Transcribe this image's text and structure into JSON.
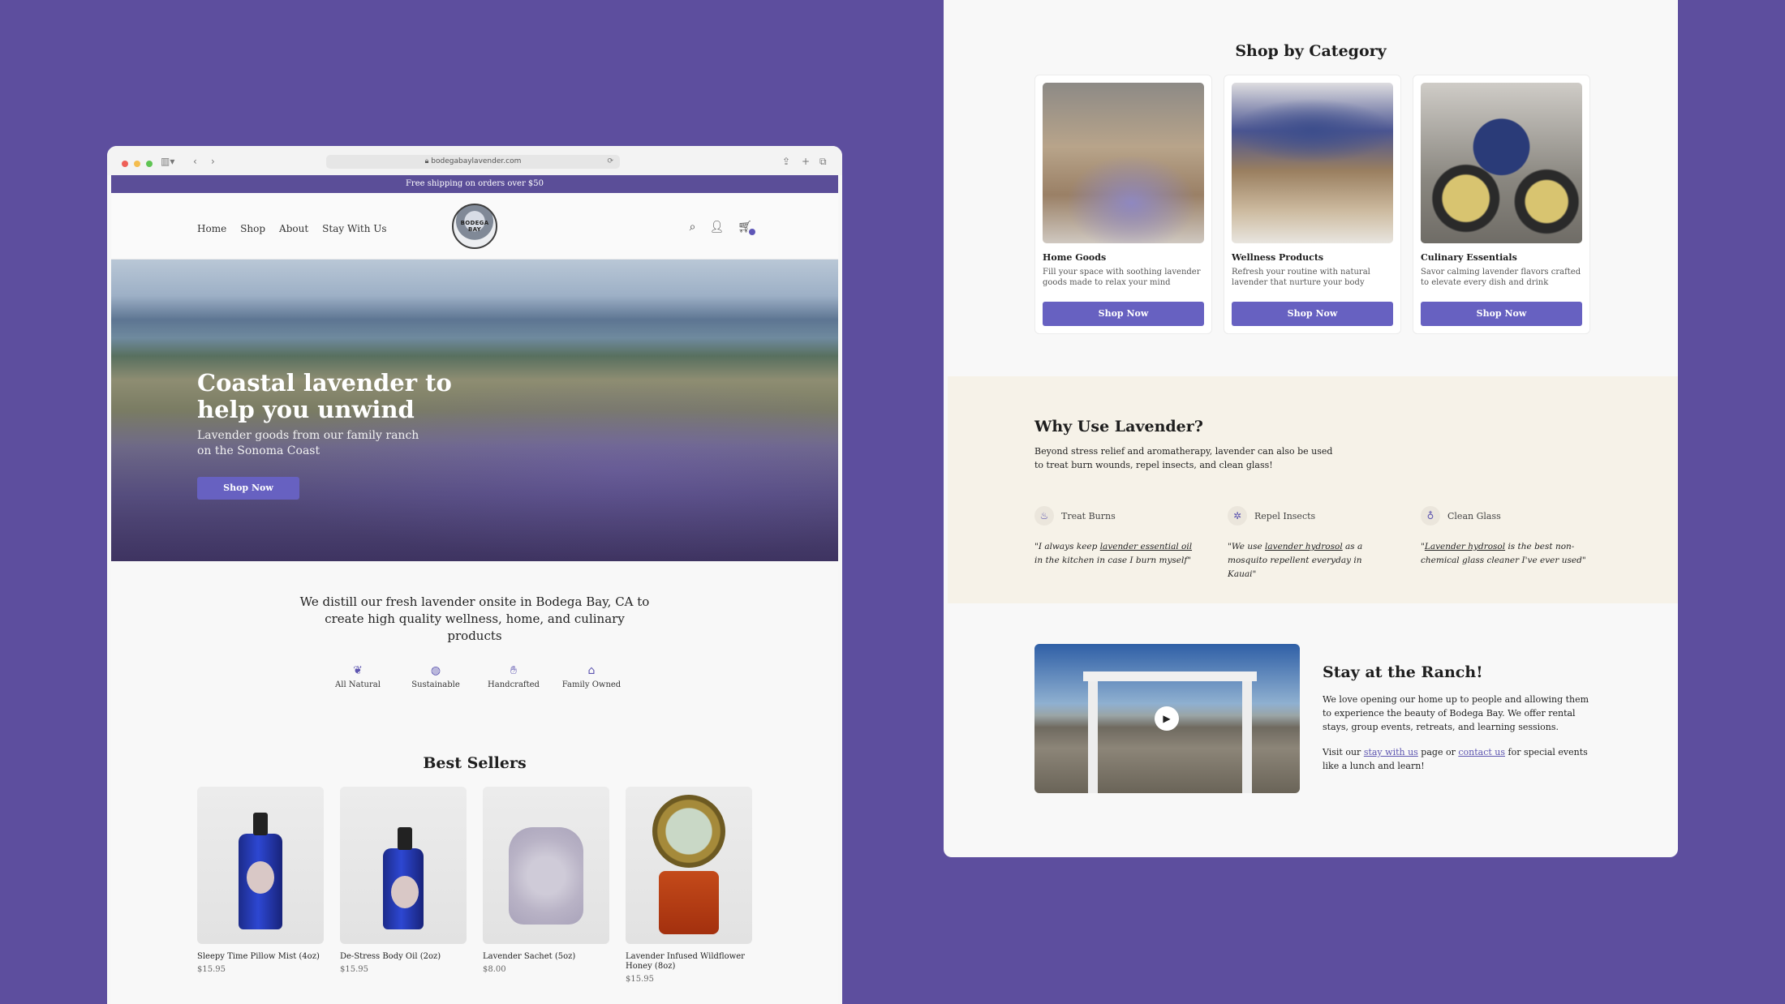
{
  "browser": {
    "url": "bodegabaylavender.com"
  },
  "announcement": "Free shipping on orders over $50",
  "nav": {
    "links": [
      "Home",
      "Shop",
      "About",
      "Stay With Us"
    ],
    "logo_text": "BODEGA BAY",
    "icons": [
      "search-icon",
      "account-icon",
      "cart-icon"
    ]
  },
  "hero": {
    "title": "Coastal lavender to help you unwind",
    "subtitle": "Lavender goods from our family ranch on the Sonoma Coast",
    "cta": "Shop Now"
  },
  "intro": "We distill our fresh lavender onsite in Bodega Bay, CA to create high quality wellness, home, and culinary products",
  "features": [
    {
      "icon": "leaf-icon",
      "label": "All Natural"
    },
    {
      "icon": "globe-icon",
      "label": "Sustainable"
    },
    {
      "icon": "hands-icon",
      "label": "Handcrafted"
    },
    {
      "icon": "house-icon",
      "label": "Family Owned"
    }
  ],
  "best_sellers": {
    "title": "Best Sellers",
    "items": [
      {
        "name": "Sleepy Time Pillow Mist (4oz)",
        "price": "$15.95"
      },
      {
        "name": "De-Stress Body Oil (2oz)",
        "price": "$15.95"
      },
      {
        "name": "Lavender Sachet (5oz)",
        "price": "$8.00"
      },
      {
        "name": "Lavender Infused Wildflower Honey (8oz)",
        "price": "$15.95"
      }
    ]
  },
  "categories": {
    "title": "Shop by Category",
    "items": [
      {
        "name": "Home Goods",
        "desc": "Fill your space with soothing lavender goods made to relax your mind",
        "cta": "Shop Now"
      },
      {
        "name": "Wellness Products",
        "desc": "Refresh your routine with natural lavender that nurture your body",
        "cta": "Shop Now"
      },
      {
        "name": "Culinary Essentials",
        "desc": "Savor calming lavender flavors crafted to elevate every dish and drink",
        "cta": "Shop Now"
      }
    ]
  },
  "why": {
    "title": "Why Use Lavender?",
    "lead": "Beyond stress relief and aromatherapy, lavender can also be used to treat burn wounds, repel insects, and clean glass!",
    "uses": [
      {
        "icon": "flame-icon",
        "label": "Treat Burns",
        "q_before": "\"I always keep ",
        "q_link": "lavender essential oil",
        "q_after": " in the kitchen in case I burn myself\""
      },
      {
        "icon": "bug-icon",
        "label": "Repel Insects",
        "q_before": "\"We use ",
        "q_link": "lavender hydrosol",
        "q_after": " as a mosquito repellent everyday in Kauai\""
      },
      {
        "icon": "glass-icon",
        "label": "Clean Glass",
        "q_before": "\"",
        "q_link": "Lavender hydrosol",
        "q_after": " is the best non-chemical glass cleaner I've ever used\""
      }
    ]
  },
  "ranch": {
    "title": "Stay at the Ranch!",
    "para1": "We love opening our home up to people and allowing them to experience the beauty of Bodega Bay. We offer rental stays, group events, retreats, and learning sessions.",
    "p2_a": "Visit our ",
    "p2_link1": "stay with us",
    "p2_b": " page or ",
    "p2_link2": "contact us",
    "p2_c": " for special events like a lunch and learn!"
  },
  "colors": {
    "background": "#5d4e9e",
    "accent": "#6761c1",
    "announce_bar": "#5b4e98",
    "why_bg": "#f6f2e8"
  }
}
